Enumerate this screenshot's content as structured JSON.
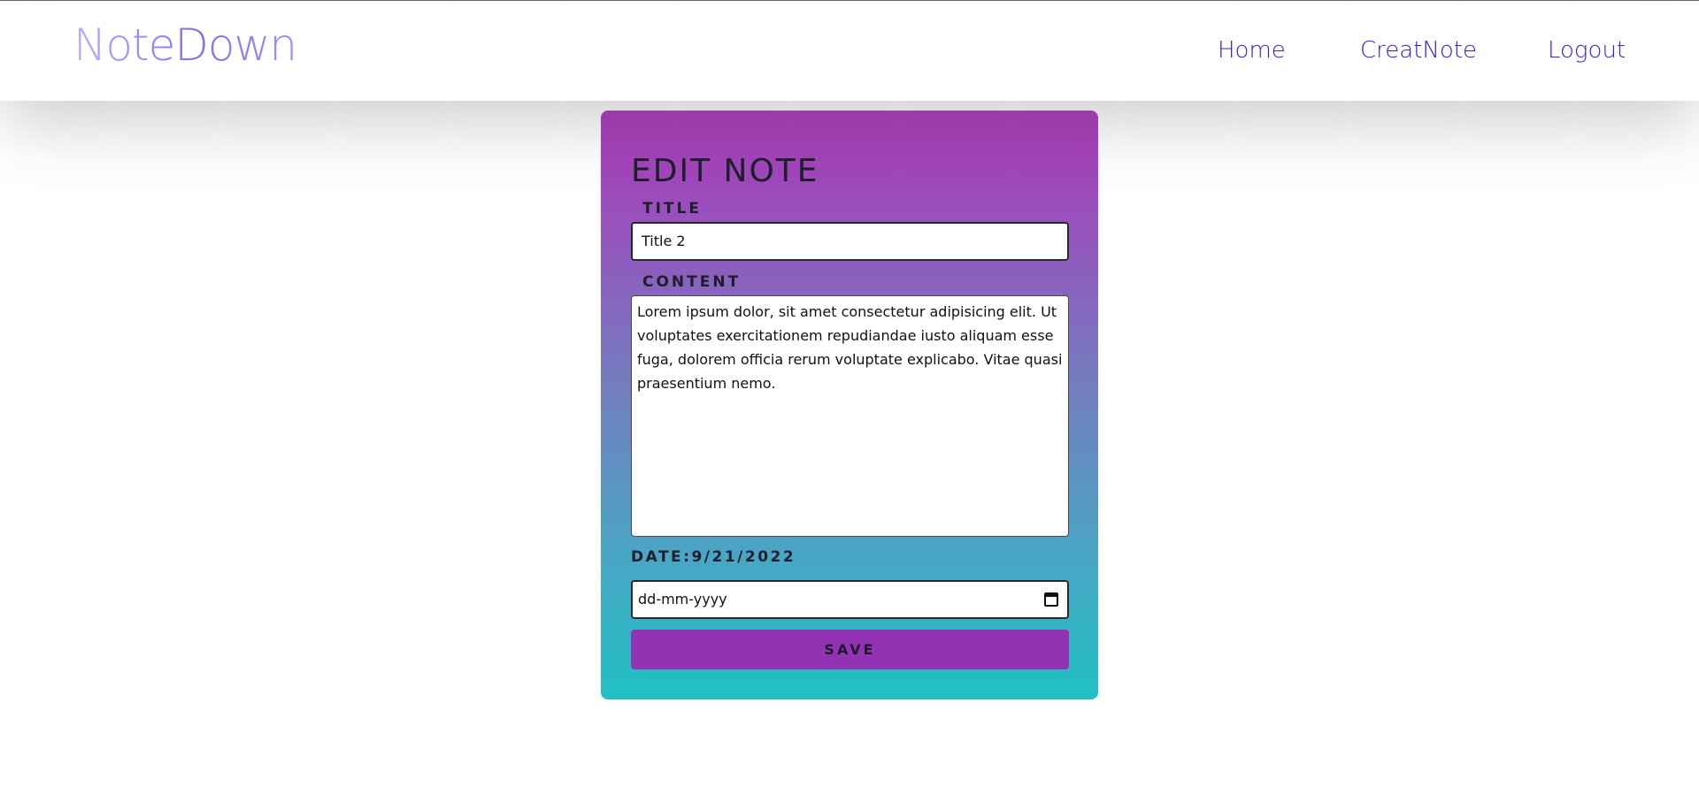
{
  "navbar": {
    "logo_text": "NoteDown",
    "links": [
      {
        "label": "Home"
      },
      {
        "label": "CreatNote"
      },
      {
        "label": "Logout"
      }
    ]
  },
  "edit_note": {
    "heading": "EDIT NOTE",
    "title_label": "TITLE",
    "title_value": "Title 2",
    "content_label": "CONTENT",
    "content_value": " Lorem ipsum dolor, sit amet consectetur adipisicing elit. Ut voluptates exercitationem repudiandae iusto aliquam esse fuga, dolorem officia rerum voluptate explicabo. Vitae quasi praesentium nemo.",
    "date_label": "DATE:9/21/2022",
    "date_placeholder": "dd-mm-yyyy",
    "save_label": "SAVE"
  },
  "icons": {
    "calendar": "calendar-icon"
  },
  "colors": {
    "nav_link": "#3a1bd0",
    "logo_gradient": [
      "#b7b0ff",
      "#7d6ff0"
    ],
    "card_gradient_top": "#ad38b8",
    "card_gradient_bottom": "#20c0c4",
    "save_button": "#9233b3"
  }
}
